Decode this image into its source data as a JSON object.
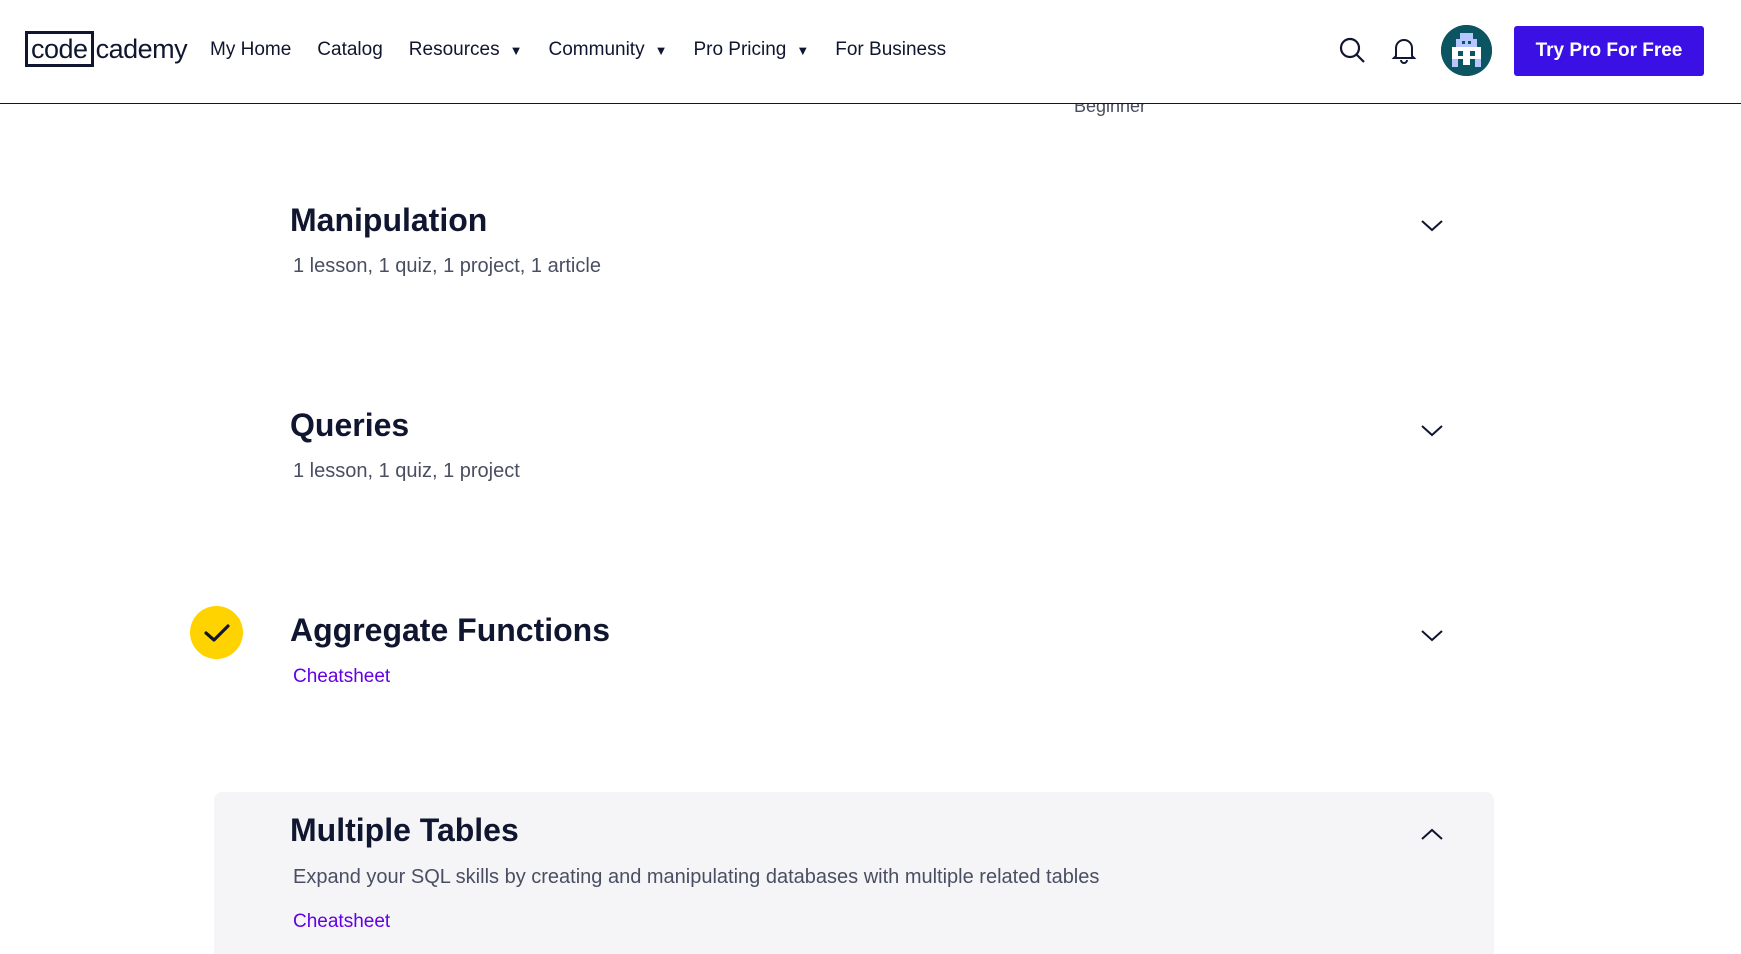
{
  "header": {
    "logo": {
      "boxed": "code",
      "rest": "cademy"
    },
    "nav": [
      {
        "label": "My Home",
        "has_caret": false
      },
      {
        "label": "Catalog",
        "has_caret": false
      },
      {
        "label": "Resources",
        "has_caret": true
      },
      {
        "label": "Community",
        "has_caret": true
      },
      {
        "label": "Pro Pricing",
        "has_caret": true
      },
      {
        "label": "For Business",
        "has_caret": false
      }
    ],
    "caret_glyph": "▼",
    "icons": [
      "search-icon",
      "bell-icon",
      "avatar"
    ],
    "cta_label": "Try Pro For Free"
  },
  "level_peek": "Beginner",
  "modules": [
    {
      "title": "Manipulation",
      "subtitle": "1 lesson, 1 quiz, 1 project, 1 article",
      "expanded": false,
      "completed": false
    },
    {
      "title": "Queries",
      "subtitle": "1 lesson, 1 quiz, 1 project",
      "expanded": false,
      "completed": false
    },
    {
      "title": "Aggregate Functions",
      "link": "Cheatsheet",
      "expanded": false,
      "completed": true
    },
    {
      "title": "Multiple Tables",
      "subtitle": "Expand your SQL skills by creating and manipulating databases with multiple related tables",
      "link": "Cheatsheet",
      "expanded": true,
      "completed": false
    }
  ],
  "colors": {
    "brand_navy": "#10162f",
    "cta_purple": "#3a10e5",
    "link_purple": "#6400e4",
    "check_yellow": "#ffd300",
    "expanded_bg": "#f5f5f8",
    "avatar_teal": "#0b5461"
  }
}
